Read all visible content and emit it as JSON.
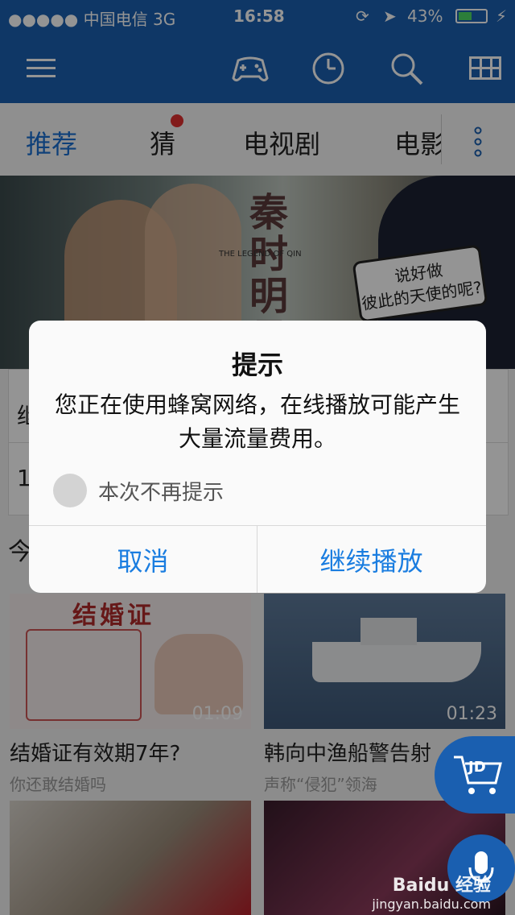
{
  "status_bar": {
    "carrier": "●●●●● 中国电信  3G",
    "time": "16:58",
    "battery": "43%"
  },
  "app_bar": {
    "icons": [
      "menu-icon",
      "gamepad-icon",
      "clock-icon",
      "search-icon",
      "grid-icon"
    ]
  },
  "tabs": [
    "推荐",
    "猜",
    "电视剧",
    "电影"
  ],
  "banner": {
    "logo_text": "秦时明月",
    "en_title": "THE LEGEND OF QIN",
    "bubble_line1": "说好做",
    "bubble_line2": "彼此的天使的呢?"
  },
  "info_card": {
    "row1": "继",
    "row2": "1"
  },
  "section": {
    "title": "今"
  },
  "videos": [
    {
      "title": "结婚证有效期7年?",
      "subtitle": "你还敢结婚吗",
      "duration": "01:09",
      "thumb_text": "结婚证"
    },
    {
      "title": "韩向中渔船警告射",
      "subtitle": "声称“侵犯”领海",
      "duration": "01:23"
    }
  ],
  "dialog": {
    "title": "提示",
    "message": "您正在使用蜂窝网络，在线播放可能产生大量流量费用。",
    "checkbox_label": "本次不再提示",
    "cancel_label": "取消",
    "continue_label": "继续播放"
  },
  "floating": {
    "jd_label": "JD"
  },
  "watermark": {
    "brand": "Baidu 经验",
    "url": "jingyan.baidu.com"
  },
  "colors": {
    "brand_blue": "#1a5fb0",
    "link_blue": "#1a7de0",
    "notification_red": "#e03030"
  }
}
